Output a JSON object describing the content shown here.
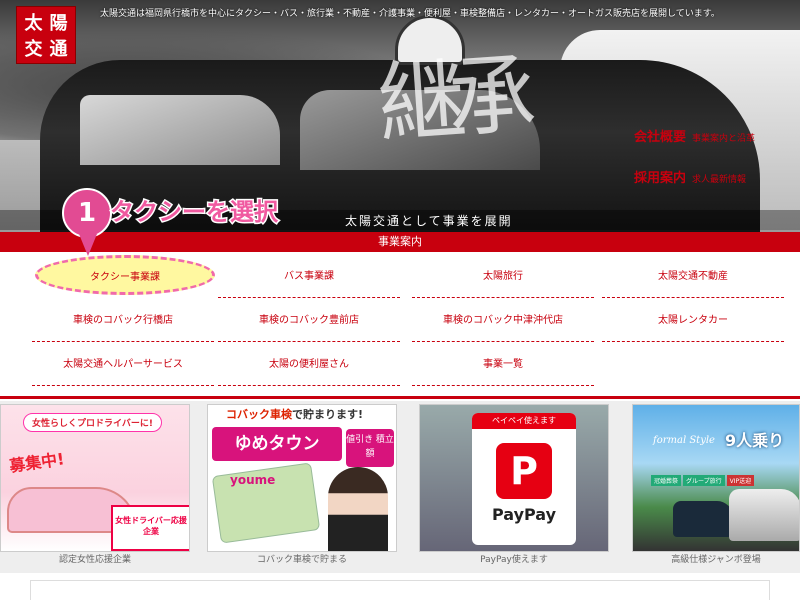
{
  "brand": {
    "logo_chars": [
      "太",
      "陽",
      "交",
      "通"
    ],
    "color": "#c8000e"
  },
  "header": {
    "tagline": "太陽交通は福岡県行橋市を中心にタクシー・バス・旅行業・不動産・介護事業・便利屋・車検整備店・レンタカー・オートガス販売店を展開しています。",
    "hero_kanji": "継承",
    "subtitle": "太陽交通として事業を展開",
    "links": [
      {
        "label": "会社概要",
        "sub": "事業案内と沿革"
      },
      {
        "label": "採用案内",
        "sub": "求人最新情報"
      }
    ]
  },
  "annotation": {
    "step": "1",
    "text": "タクシーを選択",
    "color": "#e24b93"
  },
  "nav": {
    "title": "事業案内",
    "items": [
      {
        "label": "タクシー事業課",
        "selected": true
      },
      {
        "label": "バス事業課"
      },
      {
        "label": "太陽旅行"
      },
      {
        "label": "太陽交通不動産"
      },
      {
        "label": "車検のコバック行橋店"
      },
      {
        "label": "車検のコバック豊前店"
      },
      {
        "label": "車検のコバック中津沖代店"
      },
      {
        "label": "太陽レンタカー"
      },
      {
        "label": "太陽交通ヘルパーサービス"
      },
      {
        "label": "太陽の便利屋さん"
      },
      {
        "label": "事業一覧"
      }
    ]
  },
  "banners": [
    {
      "caption": "認定女性応援企業",
      "headline": "女性らしくプロドライバーに!",
      "recruit": "募集中!",
      "badge": "女性ドライバー応援企業"
    },
    {
      "caption": "コバック車検で貯まる",
      "top_a": "コバック車検",
      "top_b": "で貯まります!",
      "yume": "ゆめタウン",
      "nebiki": "値引き 積立額",
      "youme": "youme"
    },
    {
      "caption": "PayPay使えます",
      "label": "ペイペイ使えます",
      "logo_letter": "P",
      "brand": "PayPay"
    },
    {
      "caption": "高級仕様ジャンボ登場",
      "formal": "formal Style",
      "nine": "9人乗り",
      "tags": [
        "冠婚葬祭",
        "グループ旅行",
        "VIP送迎"
      ]
    }
  ]
}
